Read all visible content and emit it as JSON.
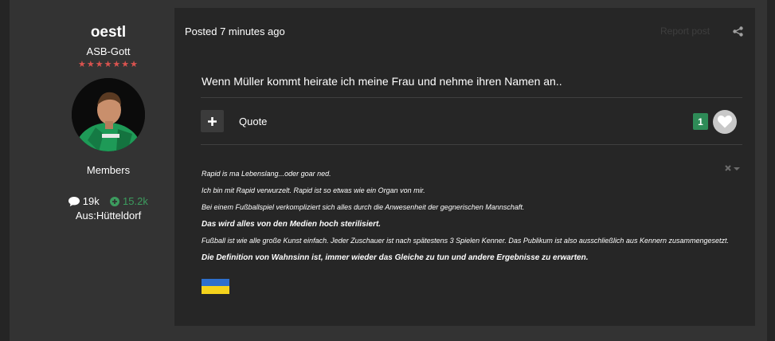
{
  "author": {
    "name": "oestl",
    "rank": "ASB-Gott",
    "stars": "★★★★★★★",
    "group": "Members",
    "posts": "19k",
    "reputation": "15.2k",
    "location": "Aus:Hütteldorf"
  },
  "post": {
    "posted": "Posted 7 minutes ago",
    "report": "Report post",
    "content": "Wenn Müller kommt heirate ich meine Frau und nehme ihren Namen an..",
    "quote_label": "Quote",
    "reaction_count": "1"
  },
  "signature": {
    "lines": [
      "Rapid is ma Lebenslang...oder goar ned.",
      "Ich bin mit Rapid verwurzelt. Rapid ist so etwas wie ein Organ von mir.",
      "Bei einem Fußballspiel verkompliziert sich alles durch die Anwesenheit der gegnerischen Mannschaft.",
      "Das wird alles von den Medien hoch sterilisiert.",
      "Fußball ist wie alle große Kunst einfach. Jeder Zuschauer ist nach spätestens 3 Spielen Kenner. Das Publikum ist also ausschließlich aus Kennern zusammengesetzt.",
      "Die Definition von Wahnsinn ist, immer wieder das Gleiche zu tun und andere Ergebnisse zu erwarten."
    ]
  },
  "colors": {
    "reputation": "#3c9b5e",
    "reaction_badge": "#2e8b57",
    "flag_blue": "#2e6fcc",
    "flag_yellow": "#f4d21c"
  },
  "icons": [
    "comment-icon",
    "plus-circle-icon",
    "share-icon",
    "plus-icon",
    "heart-icon",
    "close-icon",
    "caret-down-icon"
  ]
}
